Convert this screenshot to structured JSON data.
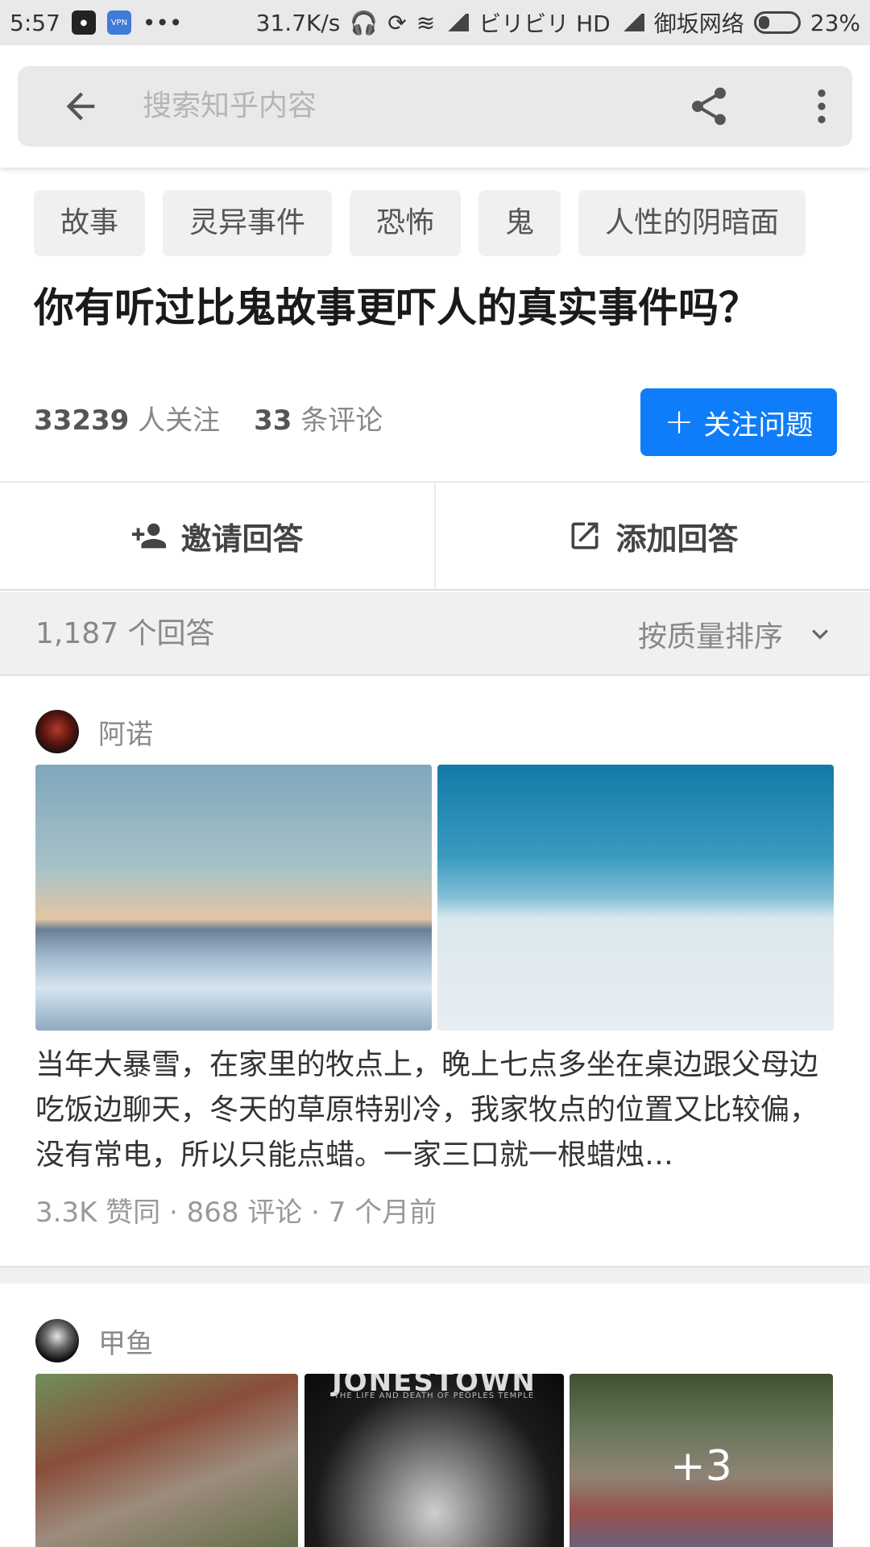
{
  "status_bar": {
    "time": "5:57",
    "app_icons": [
      "qq-icon",
      "vpn-icon"
    ],
    "vpn_label": "VPN",
    "dots": "•••",
    "speed": "31.7K/s",
    "carrier1": "ビリビリ HD",
    "carrier2": "御坂网络",
    "battery": "23%"
  },
  "search": {
    "placeholder": "搜索知乎内容"
  },
  "question": {
    "tags": [
      "故事",
      "灵异事件",
      "恐怖",
      "鬼",
      "人性的阴暗面"
    ],
    "title": "你有听过比鬼故事更吓人的真实事件吗？",
    "followers_count": "33239",
    "followers_label": "人关注",
    "comments_count": "33",
    "comments_label": "条评论",
    "follow_button": "关注问题"
  },
  "actions": {
    "invite": "邀请回答",
    "add": "添加回答"
  },
  "sort_bar": {
    "answer_count": "1,187 个回答",
    "sort_label": "按质量排序"
  },
  "answers": [
    {
      "author": "阿诺",
      "excerpt": "当年大暴雪，在家里的牧点上，晚上七点多坐在桌边跟父母边吃饭边聊天，冬天的草原特别冷，我家牧点的位置又比较偏，没有常电，所以只能点蜡。一家三口就一根蜡烛…",
      "meta": "3.3K 赞同 · 868 评论 · 7 个月前"
    },
    {
      "author": "甲鱼",
      "poster_title": "JONESTOWN",
      "poster_subtitle": "THE LIFE AND DEATH OF PEOPLES TEMPLE",
      "more_images": "+3"
    }
  ],
  "colors": {
    "accent": "#0f7dfa",
    "background_gray": "#f0f0f0"
  }
}
